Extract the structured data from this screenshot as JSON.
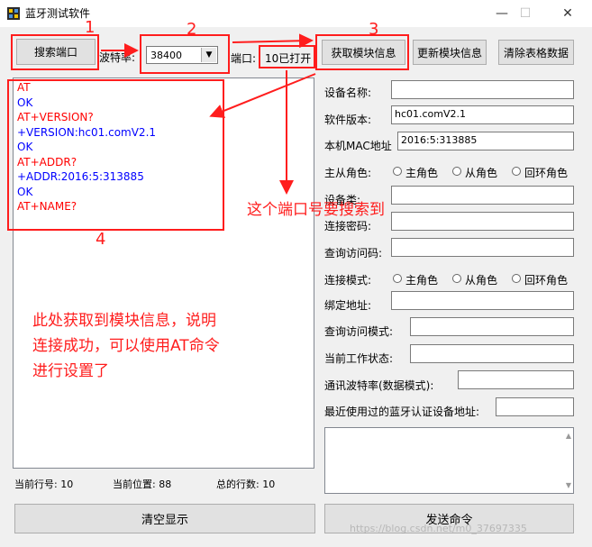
{
  "window": {
    "title": "蓝牙测试软件",
    "min": "—",
    "max": "☐",
    "close": "✕"
  },
  "toolbar": {
    "search_port": "搜索端口",
    "baud_label": "波特率:",
    "baud_value": "38400",
    "port_label": "端口:",
    "port_value": "10已打开",
    "get_info": "获取模块信息",
    "update_info": "更新模块信息",
    "clear_table": "清除表格数据"
  },
  "console_lines": [
    {
      "text": "AT",
      "color": "#ff0000"
    },
    {
      "text": "OK",
      "color": "#0000ff"
    },
    {
      "text": "AT+VERSION?",
      "color": "#ff0000"
    },
    {
      "text": "+VERSION:hc01.comV2.1",
      "color": "#0000ff"
    },
    {
      "text": "OK",
      "color": "#0000ff"
    },
    {
      "text": "AT+ADDR?",
      "color": "#ff0000"
    },
    {
      "text": "+ADDR:2016:5:313885",
      "color": "#0000ff"
    },
    {
      "text": "OK",
      "color": "#0000ff"
    },
    {
      "text": "AT+NAME?",
      "color": "#ff0000"
    }
  ],
  "annotations": {
    "n1": "1",
    "n2": "2",
    "n3": "3",
    "n4": "4",
    "port_note": "这个端口号要搜索到",
    "success_note": [
      "此处获取到模块信息，说明",
      "连接成功，可以使用AT命令",
      "进行设置了"
    ]
  },
  "status": {
    "line": "当前行号:  10",
    "pos": "当前位置:  88",
    "total": "总的行数:  10"
  },
  "buttons": {
    "clear_display": "清空显示",
    "send": "发送命令"
  },
  "form": {
    "device_name": "设备名称:",
    "software_version": "软件版本:",
    "software_version_value": "hc01.comV2.1",
    "mac_label": "本机MAC地址",
    "mac_value": "2016:5:313885",
    "role_label": "主从角色:",
    "role_master": "主角色",
    "role_slave": "从角色",
    "role_loop": "回环角色",
    "device_class": "设备类:",
    "pin": "连接密码:",
    "inquiry_code": "查询访问码:",
    "conn_mode": "连接模式:",
    "bind_addr": "绑定地址:",
    "inquiry_mode": "查询访问模式:",
    "work_state": "当前工作状态:",
    "uart_baud": "通讯波特率(数据模式):",
    "last_paired": "最近使用过的蓝牙认证设备地址:"
  },
  "watermark": "https://blog.csdn.net/m0_37697335",
  "colors": {
    "annotation": "#ff1d1d",
    "at_command": "#ff0000",
    "response": "#0000ff"
  }
}
